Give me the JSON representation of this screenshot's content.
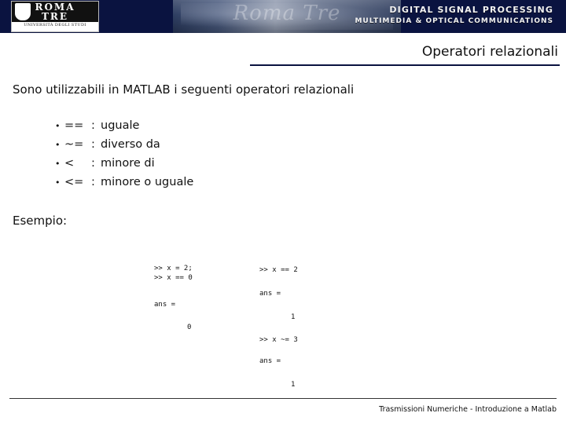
{
  "header": {
    "logo": {
      "line1": "ROMA",
      "line2": "TRE",
      "subtitle": "UNIVERSITÀ DEGLI STUDI"
    },
    "photo_caption": "Roma Tre",
    "dsp_title_line1": "DIGITAL SIGNAL PROCESSING",
    "dsp_title_line2": "MULTIMEDIA  &  OPTICAL  COMMUNICATIONS"
  },
  "slide": {
    "title": "Operatori relazionali",
    "intro": "Sono utilizzabili in MATLAB i seguenti operatori relazionali",
    "bullets": [
      {
        "marker": "•",
        "operator": "==",
        "colon": ":",
        "definition": "uguale"
      },
      {
        "marker": "•",
        "operator": "~=",
        "colon": ":",
        "definition": "diverso da"
      },
      {
        "marker": "•",
        "operator": "<",
        "colon": ":",
        "definition": "minore di"
      },
      {
        "marker": "•",
        "operator": "<=",
        "colon": ":",
        "definition": "minore o uguale"
      }
    ],
    "example_label": "Esempio:",
    "code": {
      "left_1": ">> x = 2;\n>> x == 0",
      "left_2": "ans =",
      "left_3": "0",
      "right_1": ">> x == 2",
      "right_2": "ans =",
      "right_3": "1",
      "right_4": ">> x ~= 3",
      "right_5": "ans =",
      "right_6": "1"
    }
  },
  "footer": {
    "text": "Trasmissioni Numeriche - Introduzione a Matlab"
  },
  "colors": {
    "banner": "#0a1340",
    "rule": "#0a1340",
    "text": "#111111"
  }
}
